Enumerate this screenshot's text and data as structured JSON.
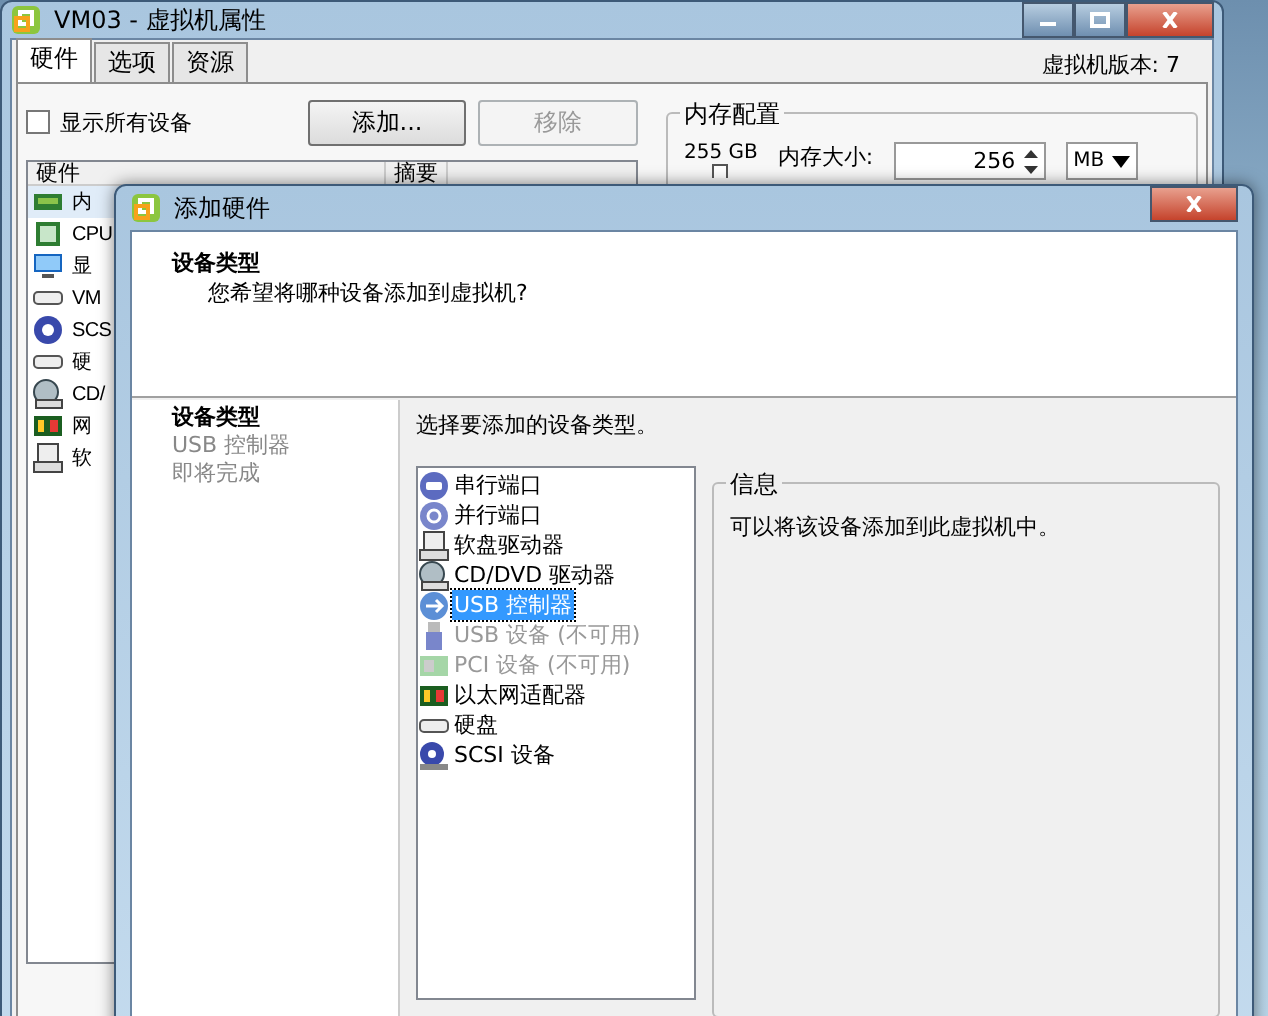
{
  "main_window": {
    "title": "VM03 - 虚拟机属性",
    "tabs": [
      {
        "label": "硬件",
        "selected": true
      },
      {
        "label": "选项",
        "selected": false
      },
      {
        "label": "资源",
        "selected": false
      }
    ],
    "version": "虚拟机版本: 7",
    "show_all": {
      "label": "显示所有设备",
      "checked": false
    },
    "buttons": [
      {
        "label": "添加...",
        "disabled": false
      },
      {
        "label": "移除",
        "disabled": true
      }
    ],
    "table": {
      "columns": [
        "硬件",
        "摘要"
      ],
      "rows": [
        "内",
        "CPU",
        "显",
        "VM",
        "SCS",
        "硬",
        "CD/",
        "网",
        "软"
      ]
    },
    "memory": {
      "title": "内存配置",
      "max": "255 GB",
      "size_label": "内存大小:",
      "size": "256",
      "unit": "MB"
    }
  },
  "dialog": {
    "title": "添加硬件",
    "header": {
      "title": "设备类型",
      "subtitle": "您希望将哪种设备添加到虚拟机?"
    },
    "steps": [
      {
        "label": "设备类型",
        "selected": true
      },
      {
        "label": "USB 控制器",
        "selected": false
      },
      {
        "label": "即将完成",
        "selected": false
      }
    ],
    "prompt": "选择要添加的设备类型。",
    "devices": [
      {
        "label": "串行端口",
        "selected": false,
        "disabled": false
      },
      {
        "label": "并行端口",
        "selected": false,
        "disabled": false
      },
      {
        "label": "软盘驱动器",
        "selected": false,
        "disabled": false
      },
      {
        "label": "CD/DVD 驱动器",
        "selected": false,
        "disabled": false
      },
      {
        "label": "USB 控制器",
        "selected": true,
        "disabled": false
      },
      {
        "label": "USB 设备 (不可用)",
        "selected": false,
        "disabled": true
      },
      {
        "label": "PCI 设备 (不可用)",
        "selected": false,
        "disabled": true
      },
      {
        "label": "以太网适配器",
        "selected": false,
        "disabled": false
      },
      {
        "label": "硬盘",
        "selected": false,
        "disabled": false
      },
      {
        "label": "SCSI 设备",
        "selected": false,
        "disabled": false
      }
    ],
    "info": {
      "title": "信息",
      "text": "可以将该设备添加到此虚拟机中。"
    }
  }
}
